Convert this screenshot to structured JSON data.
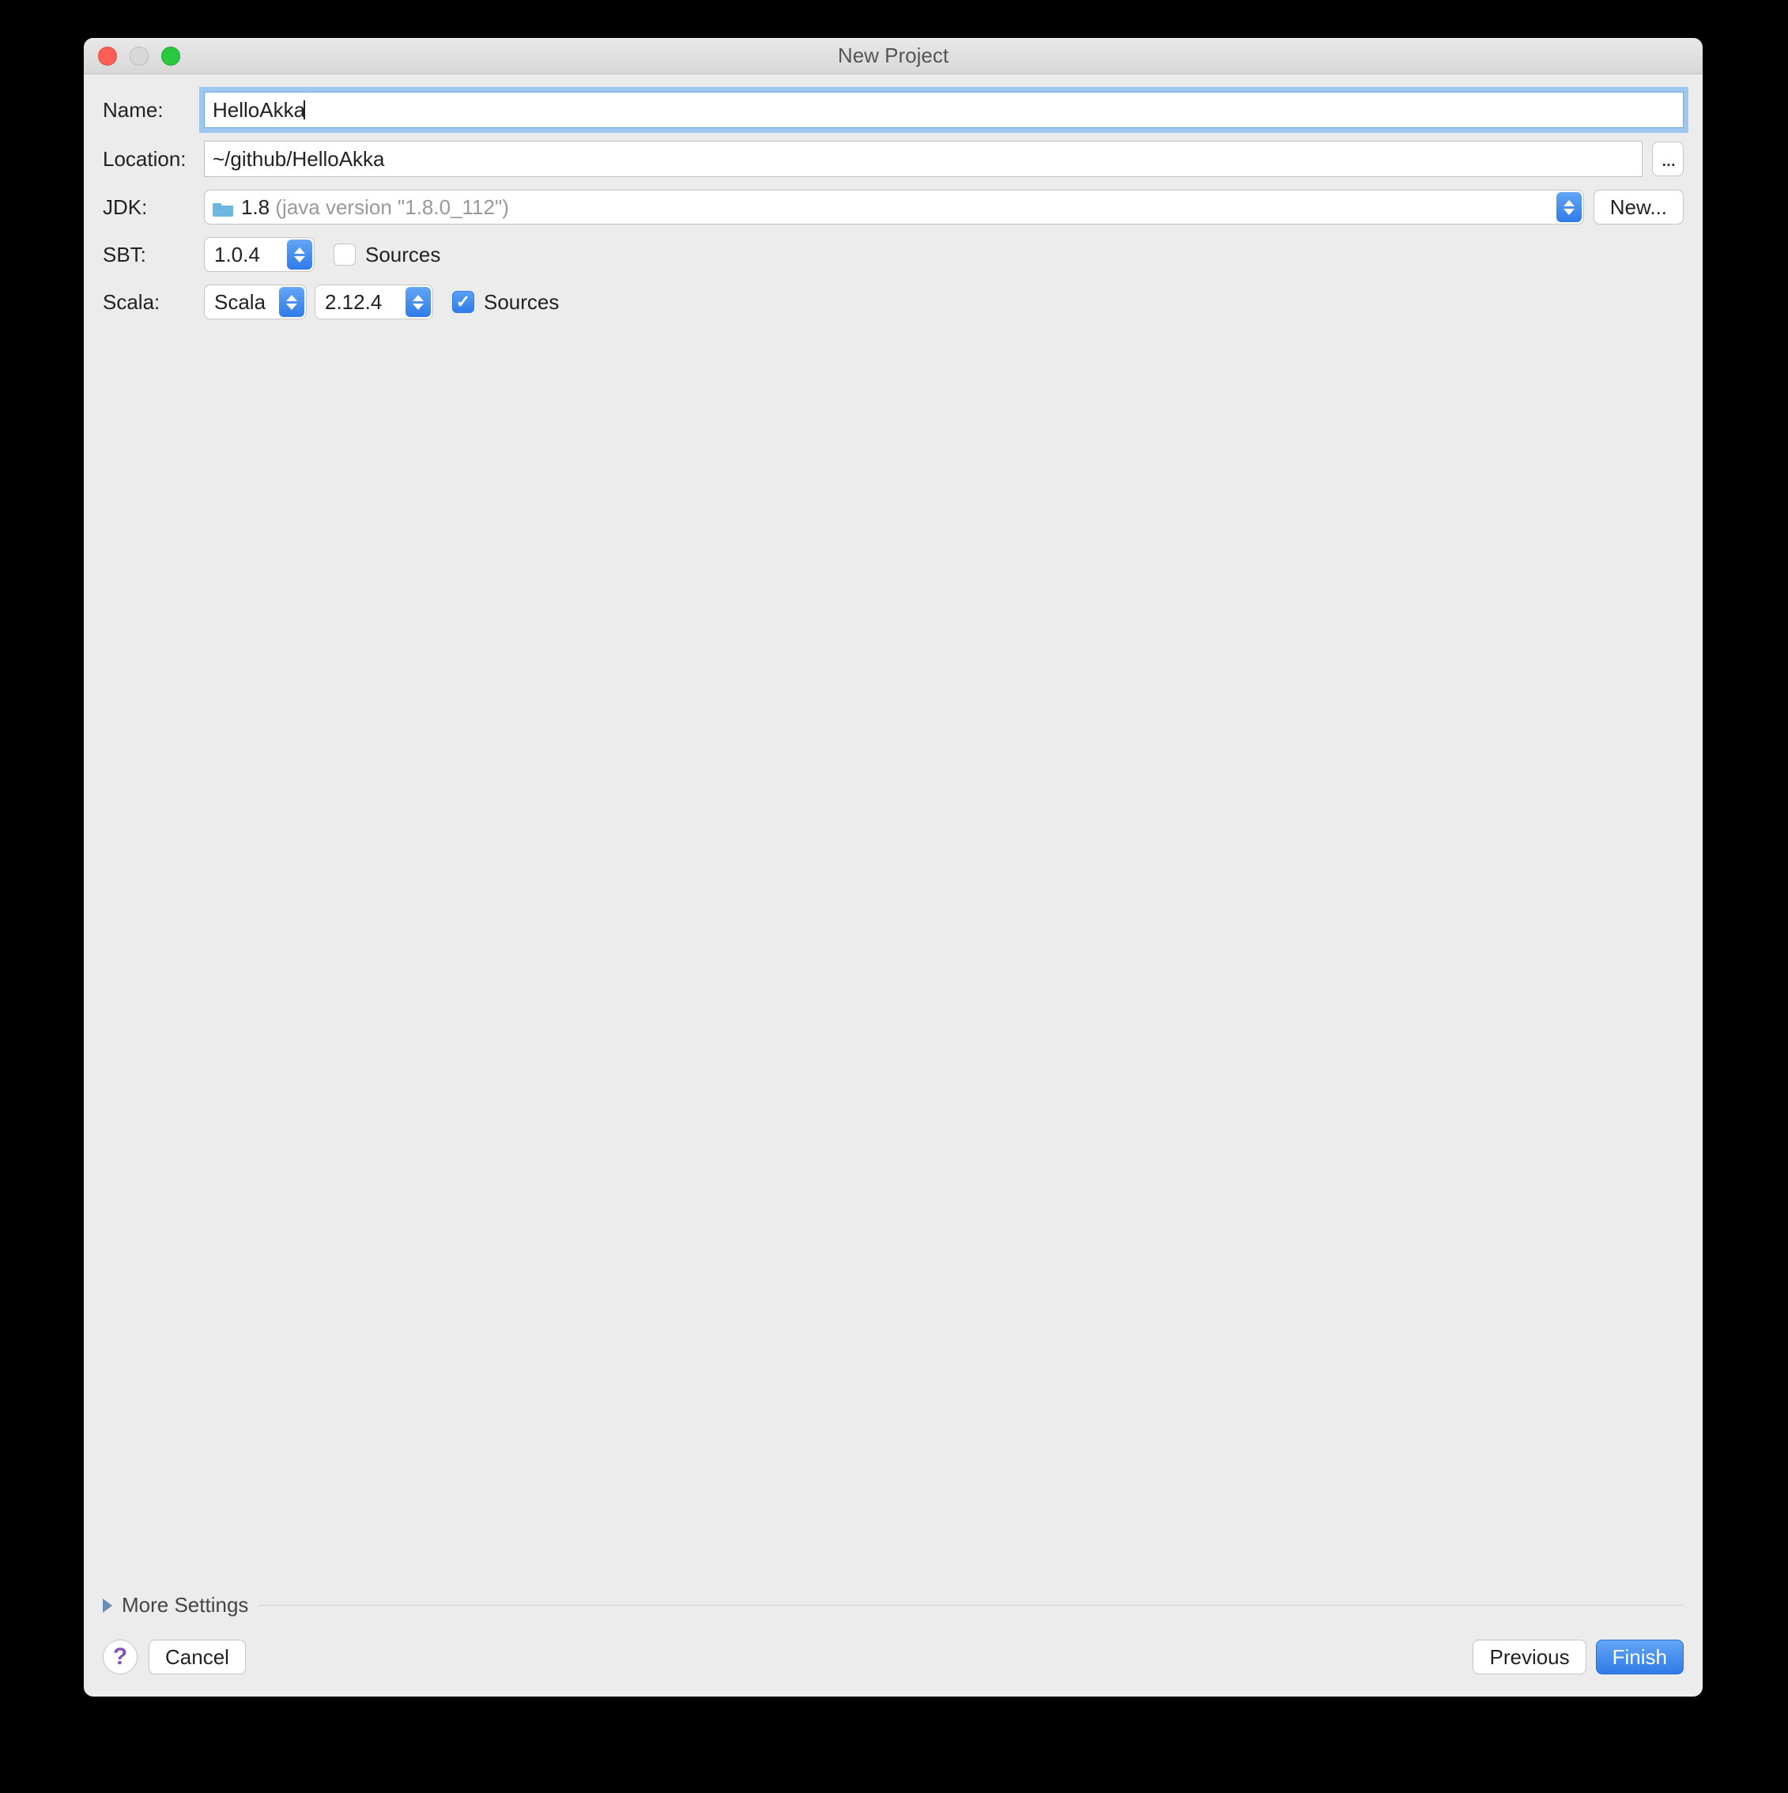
{
  "window": {
    "title": "New Project"
  },
  "labels": {
    "name": "Name:",
    "location": "Location:",
    "jdk": "JDK:",
    "sbt": "SBT:",
    "scala": "Scala:"
  },
  "fields": {
    "name_value": "HelloAkka",
    "location_value": "~/github/HelloAkka",
    "browse_label": "...",
    "jdk_version": "1.8",
    "jdk_detail": "(java version \"1.8.0_112\")",
    "new_label": "New...",
    "sbt_version": "1.0.4",
    "sbt_sources_label": "Sources",
    "scala_kind": "Scala",
    "scala_version": "2.12.4",
    "scala_sources_label": "Sources"
  },
  "more_settings": "More Settings",
  "footer": {
    "help": "?",
    "cancel": "Cancel",
    "previous": "Previous",
    "finish": "Finish"
  }
}
